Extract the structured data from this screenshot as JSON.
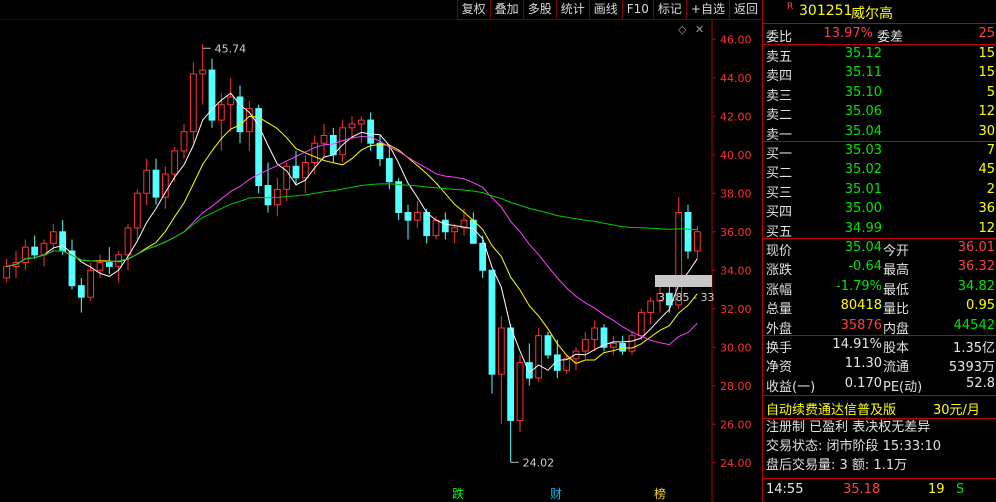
{
  "toolbar": {
    "buttons": [
      {
        "label": "复权",
        "name": "restore-rights-button"
      },
      {
        "label": "叠加",
        "name": "overlay-button"
      },
      {
        "label": "多股",
        "name": "multi-stock-button"
      },
      {
        "label": "统计",
        "name": "statistics-button"
      },
      {
        "label": "画线",
        "name": "draw-line-button"
      },
      {
        "label": "F10",
        "name": "f10-button"
      },
      {
        "label": "标记",
        "name": "mark-button"
      },
      {
        "label": "+自选",
        "name": "add-watchlist-button"
      },
      {
        "label": "返回",
        "name": "back-button"
      }
    ]
  },
  "chart": {
    "high_label": "45.74",
    "low_label": "24.02",
    "current_label": "32.85 - 33",
    "markers": [
      {
        "text": "跌",
        "color": "#00ff00"
      },
      {
        "text": "财",
        "color": "#00bfff"
      },
      {
        "text": "榜",
        "color": "#ffd700"
      }
    ],
    "icons": {
      "diamond": "diamond-icon",
      "cross": "crosshair-icon"
    }
  },
  "chart_data": {
    "type": "candlestick",
    "ylim": [
      23,
      47
    ],
    "y_ticks": [
      "46.00",
      "44.00",
      "42.00",
      "40.00",
      "38.00",
      "36.00",
      "34.00",
      "32.00",
      "30.00",
      "28.00",
      "26.00",
      "24.00"
    ],
    "candles": [
      [
        33.6,
        34.6,
        33.4,
        34.2
      ],
      [
        34.2,
        35.0,
        33.6,
        34.4
      ],
      [
        34.4,
        35.6,
        34.0,
        35.2
      ],
      [
        35.2,
        35.8,
        34.6,
        34.8
      ],
      [
        34.8,
        35.6,
        34.2,
        35.4
      ],
      [
        35.4,
        36.4,
        35.0,
        36.0
      ],
      [
        36.0,
        36.6,
        34.8,
        35.0
      ],
      [
        35.0,
        35.6,
        33.0,
        33.2
      ],
      [
        33.2,
        33.6,
        31.8,
        32.6
      ],
      [
        32.6,
        34.4,
        32.4,
        34.0
      ],
      [
        34.0,
        34.8,
        33.6,
        34.4
      ],
      [
        34.4,
        35.2,
        33.8,
        34.2
      ],
      [
        34.2,
        35.0,
        33.4,
        34.8
      ],
      [
        34.8,
        36.4,
        34.0,
        36.2
      ],
      [
        36.2,
        38.2,
        35.6,
        38.0
      ],
      [
        38.0,
        39.8,
        37.4,
        39.2
      ],
      [
        39.2,
        39.8,
        37.4,
        37.8
      ],
      [
        37.8,
        39.4,
        37.2,
        39.0
      ],
      [
        39.0,
        40.4,
        38.6,
        40.2
      ],
      [
        40.2,
        41.6,
        39.8,
        41.2
      ],
      [
        41.2,
        44.8,
        40.6,
        44.2
      ],
      [
        44.2,
        45.74,
        42.6,
        44.4
      ],
      [
        44.4,
        45.0,
        41.4,
        41.8
      ],
      [
        41.8,
        43.2,
        40.2,
        42.6
      ],
      [
        42.6,
        44.0,
        41.2,
        43.0
      ],
      [
        43.0,
        43.6,
        40.6,
        41.2
      ],
      [
        41.2,
        42.8,
        40.2,
        42.4
      ],
      [
        42.4,
        42.6,
        38.0,
        38.4
      ],
      [
        38.4,
        39.6,
        37.0,
        37.4
      ],
      [
        37.4,
        38.8,
        36.8,
        38.2
      ],
      [
        38.2,
        39.6,
        37.6,
        39.4
      ],
      [
        39.4,
        40.2,
        38.4,
        38.8
      ],
      [
        38.8,
        40.0,
        38.0,
        39.6
      ],
      [
        39.6,
        41.0,
        39.0,
        40.6
      ],
      [
        40.6,
        41.6,
        39.8,
        41.0
      ],
      [
        41.0,
        41.4,
        39.6,
        40.0
      ],
      [
        40.0,
        41.8,
        39.6,
        41.4
      ],
      [
        41.4,
        42.0,
        40.8,
        41.6
      ],
      [
        41.6,
        42.0,
        40.6,
        41.8
      ],
      [
        41.8,
        42.2,
        40.2,
        40.6
      ],
      [
        40.6,
        41.0,
        39.4,
        39.8
      ],
      [
        39.8,
        40.4,
        38.2,
        38.6
      ],
      [
        38.6,
        38.8,
        36.6,
        37.0
      ],
      [
        37.0,
        37.4,
        35.6,
        36.6
      ],
      [
        36.6,
        37.6,
        36.2,
        37.0
      ],
      [
        37.0,
        37.2,
        35.4,
        35.8
      ],
      [
        35.8,
        36.8,
        35.6,
        36.6
      ],
      [
        36.6,
        37.0,
        35.6,
        36.0
      ],
      [
        36.0,
        36.4,
        35.4,
        36.2
      ],
      [
        36.2,
        37.2,
        35.8,
        36.6
      ],
      [
        36.6,
        37.0,
        35.6,
        35.4
      ],
      [
        35.4,
        35.8,
        33.6,
        34.0
      ],
      [
        34.0,
        33.6,
        27.6,
        28.6
      ],
      [
        28.6,
        31.6,
        26.0,
        31.0
      ],
      [
        31.0,
        31.2,
        24.02,
        26.2
      ],
      [
        26.2,
        29.6,
        25.6,
        29.2
      ],
      [
        29.2,
        30.2,
        28.0,
        28.4
      ],
      [
        28.4,
        31.0,
        28.2,
        30.6
      ],
      [
        30.6,
        30.8,
        29.4,
        29.6
      ],
      [
        29.6,
        30.4,
        28.4,
        28.8
      ],
      [
        28.8,
        29.6,
        28.6,
        29.4
      ],
      [
        29.4,
        30.0,
        28.8,
        29.8
      ],
      [
        29.8,
        30.8,
        29.4,
        30.4
      ],
      [
        30.4,
        31.4,
        29.8,
        31.0
      ],
      [
        31.0,
        31.2,
        29.8,
        30.0
      ],
      [
        30.0,
        30.6,
        29.6,
        30.2
      ],
      [
        30.2,
        30.6,
        29.6,
        29.8
      ],
      [
        29.8,
        30.8,
        29.6,
        30.6
      ],
      [
        30.6,
        32.0,
        30.4,
        31.8
      ],
      [
        31.8,
        32.6,
        31.2,
        32.4
      ],
      [
        32.4,
        33.2,
        31.8,
        32.8
      ],
      [
        32.8,
        33.4,
        31.8,
        32.2
      ],
      [
        32.2,
        37.8,
        32.0,
        37.0
      ],
      [
        37.0,
        37.4,
        34.6,
        35.0
      ],
      [
        35.0,
        36.3,
        34.6,
        36.0
      ]
    ],
    "ma_lines": [
      {
        "color": "#ffffff"
      },
      {
        "color": "#ffff00"
      },
      {
        "color": "#ff40ff"
      },
      {
        "color": "#00cc00"
      }
    ]
  },
  "quote": {
    "code": "301251",
    "name": "威尔高",
    "r_mark": "R",
    "weibi": {
      "label": "委比",
      "value": "13.97%",
      "label2": "委差",
      "value2": "25"
    },
    "asks": [
      {
        "label": "卖五",
        "price": "35.12",
        "vol": "15"
      },
      {
        "label": "卖四",
        "price": "35.11",
        "vol": "15"
      },
      {
        "label": "卖三",
        "price": "35.10",
        "vol": "5"
      },
      {
        "label": "卖二",
        "price": "35.06",
        "vol": "12"
      },
      {
        "label": "卖一",
        "price": "35.04",
        "vol": "30"
      }
    ],
    "bids": [
      {
        "label": "买一",
        "price": "35.03",
        "vol": "7"
      },
      {
        "label": "买二",
        "price": "35.02",
        "vol": "45"
      },
      {
        "label": "买三",
        "price": "35.01",
        "vol": "2"
      },
      {
        "label": "买四",
        "price": "35.00",
        "vol": "36"
      },
      {
        "label": "买五",
        "price": "34.99",
        "vol": "12"
      }
    ],
    "stats": [
      {
        "l1": "现价",
        "v1": "35.04",
        "c1": "green",
        "l2": "今开",
        "v2": "36.01",
        "c2": "red"
      },
      {
        "l1": "涨跌",
        "v1": "-0.64",
        "c1": "green",
        "l2": "最高",
        "v2": "36.32",
        "c2": "red"
      },
      {
        "l1": "涨幅",
        "v1": "-1.79%",
        "c1": "green",
        "l2": "最低",
        "v2": "34.82",
        "c2": "green"
      },
      {
        "l1": "总量",
        "v1": "80418",
        "c1": "yellow",
        "l2": "量比",
        "v2": "0.95",
        "c2": "yellow"
      },
      {
        "l1": "外盘",
        "v1": "35876",
        "c1": "red",
        "l2": "内盘",
        "v2": "44542",
        "c2": "green"
      }
    ],
    "stats2": [
      {
        "l1": "换手",
        "v1": "14.91%",
        "l2": "股本",
        "v2": "1.35亿"
      },
      {
        "l1": "净资",
        "v1": "11.30",
        "l2": "流通",
        "v2": "5393万"
      },
      {
        "l1": "收益(一)",
        "v1": "0.170",
        "l2": "PE(动)",
        "v2": "52.8"
      }
    ],
    "promo": {
      "text": "自动续费通达信普及版",
      "price": "30元/月"
    },
    "info": [
      "注册制 已盈利 表决权无差异",
      "交易状态: 闭市阶段 15:33:10",
      "盘后交易量: 3  额: 1.1万"
    ],
    "tick": {
      "time": "14:55",
      "price": "35.18",
      "vol": "19",
      "side": "S"
    }
  }
}
